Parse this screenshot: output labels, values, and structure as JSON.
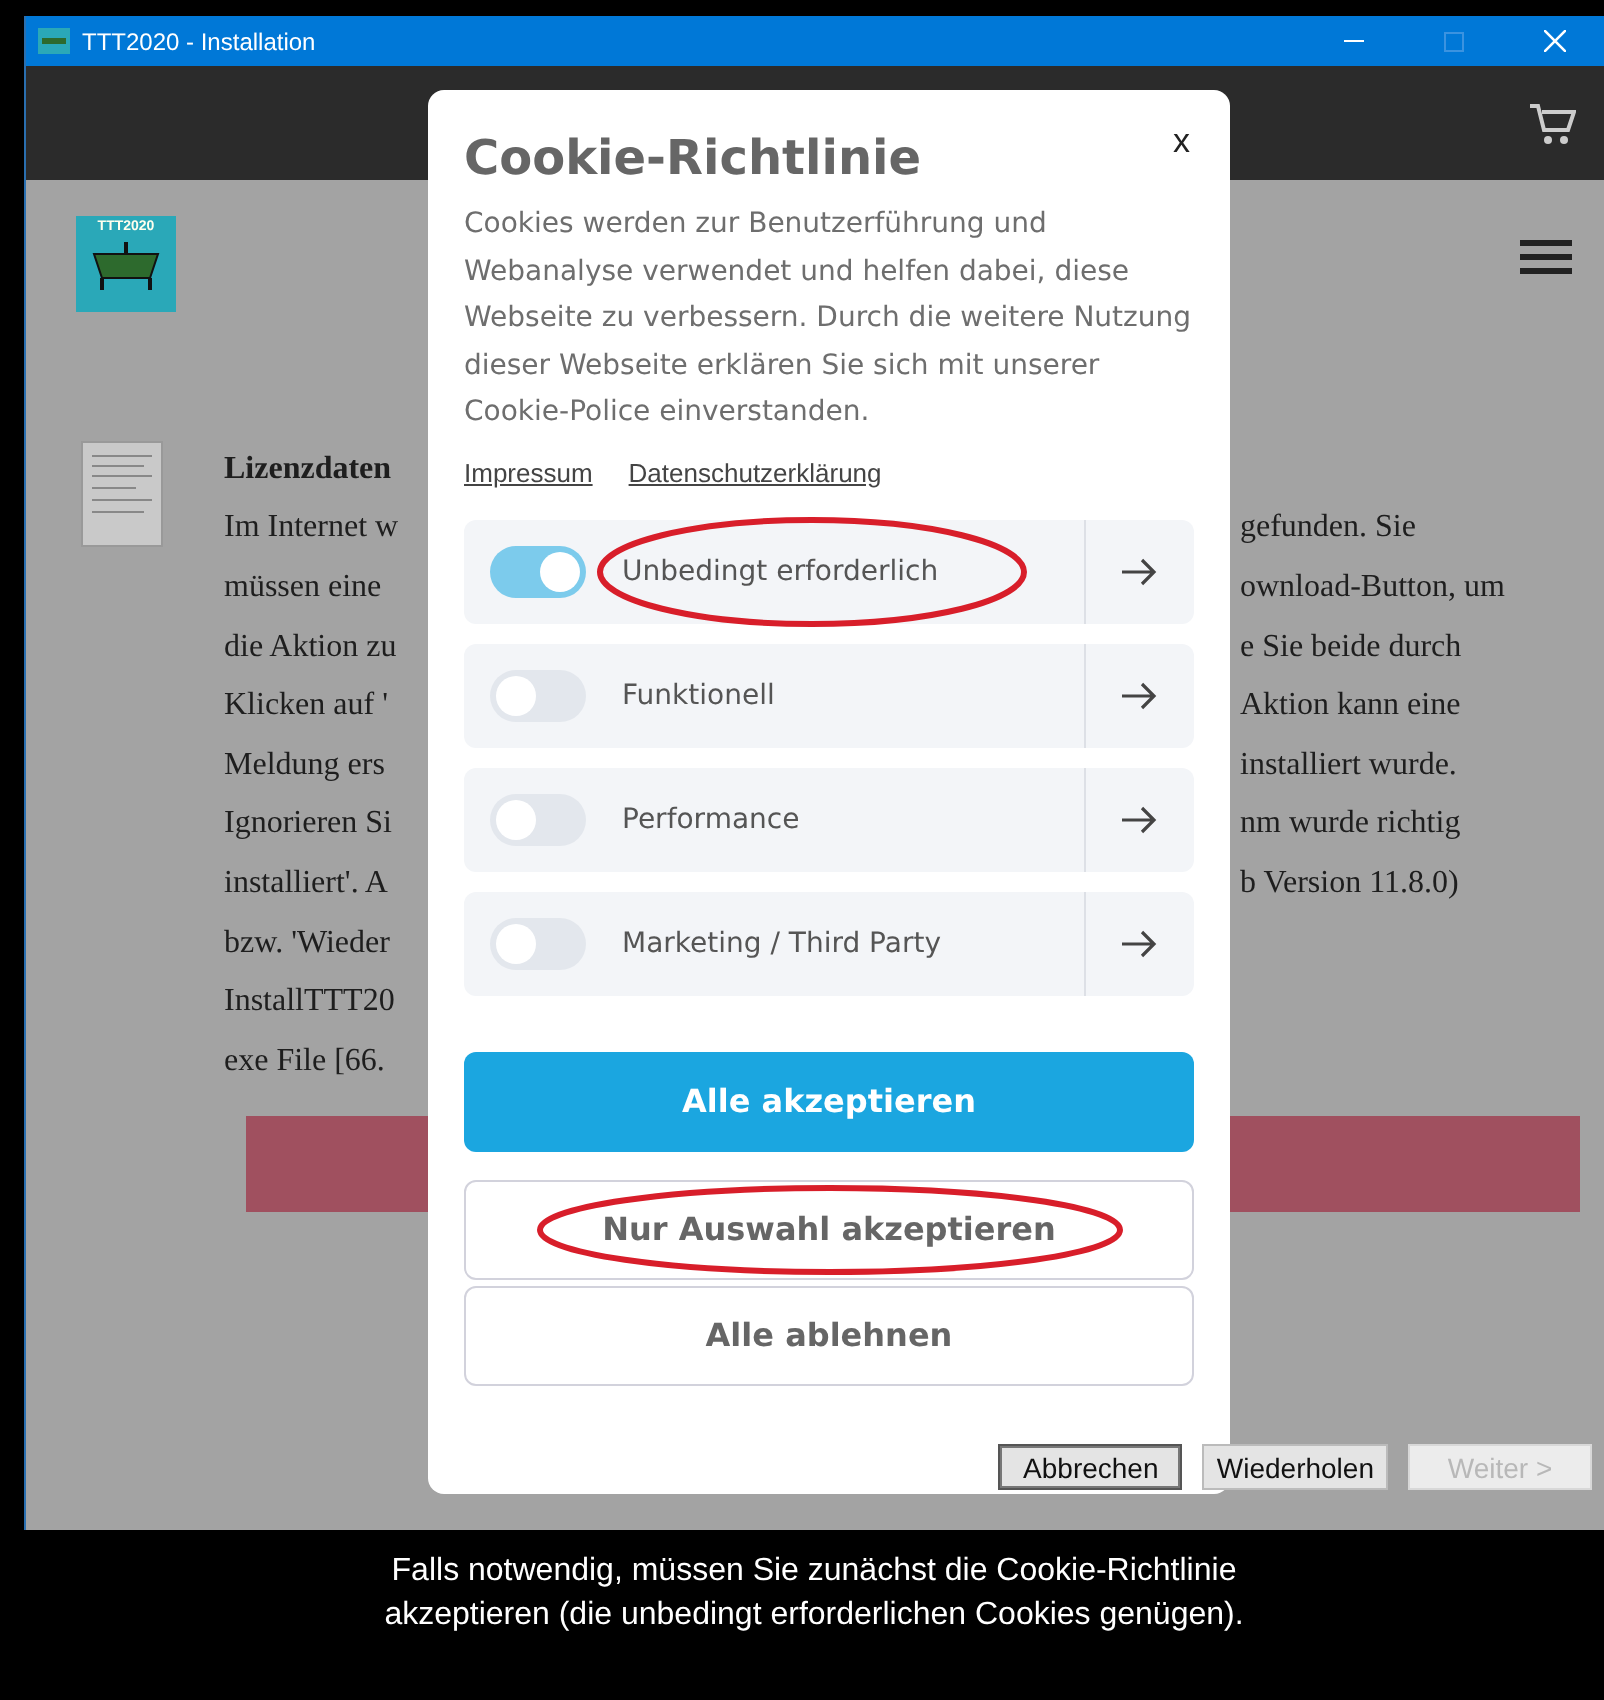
{
  "window": {
    "title": "TTT2020 - Installation"
  },
  "logo": {
    "text": "TTT2020"
  },
  "document": {
    "heading": "Lizenzdaten",
    "lines_left": [
      "Im Internet w",
      "müssen eine",
      "die Aktion zu",
      "Klicken auf '",
      "Meldung ers",
      "Ignorieren Si",
      "installiert'. A",
      "bzw. 'Wieder",
      "InstallTTT20",
      "exe File [66."
    ],
    "lines_right": [
      "gefunden. Sie",
      "ownload-Button, um",
      "e Sie beide durch",
      "Aktion kann eine",
      "installiert wurde.",
      "nm wurde richtig",
      "b Version 11.8.0)"
    ]
  },
  "cookie_dialog": {
    "title": "Cookie-Richtlinie",
    "close": "x",
    "text": "Cookies werden zur Benutzerführung und Webanalyse verwendet und helfen dabei, diese Webseite zu verbessern. Durch die weitere Nutzung dieser Webseite erklären Sie sich mit unserer Cookie-Police einverstanden.",
    "links": [
      "Impressum",
      "Datenschutzerklärung"
    ],
    "categories": [
      {
        "label": "Unbedingt erforderlich",
        "on": true,
        "highlighted": true
      },
      {
        "label": "Funktionell",
        "on": false,
        "highlighted": false
      },
      {
        "label": "Performance",
        "on": false,
        "highlighted": false
      },
      {
        "label": "Marketing / Third Party",
        "on": false,
        "highlighted": false
      }
    ],
    "buttons": [
      {
        "label": "Alle akzeptieren",
        "kind": "primary",
        "highlighted": false
      },
      {
        "label": "Nur Auswahl akzeptieren",
        "kind": "secondary",
        "highlighted": true
      },
      {
        "label": "Alle ablehnen",
        "kind": "secondary",
        "highlighted": false
      }
    ]
  },
  "wizard_buttons": [
    {
      "label": "Abbrechen",
      "disabled": false,
      "selected": true
    },
    {
      "label": "Wiederholen",
      "disabled": false,
      "selected": false
    },
    {
      "label": "Weiter >",
      "disabled": true,
      "selected": false
    }
  ],
  "caption": "Falls notwendig, müssen Sie zunächst die Cookie-Richtlinie akzeptieren (die unbedingt erforderlichen Cookies genügen)."
}
